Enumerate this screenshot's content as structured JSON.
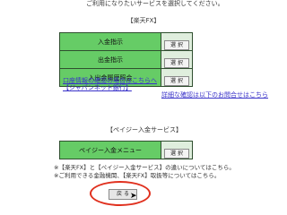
{
  "intro": "ご利用になりたいサービスを選択してください。",
  "section1": {
    "heading": "【楽天FX】",
    "rows": [
      {
        "label": "入金指示",
        "button": "選 択"
      },
      {
        "label": "出金指示",
        "button": "選 択"
      },
      {
        "label": "入出金履歴照会",
        "button": "選 択"
      }
    ],
    "link_line1": "口座情報の確認の場合はこちらへ",
    "link_line2": "【ジャパンネット銀行】",
    "right_link": "詳細な確認は以下のお問合せはこちら"
  },
  "section2": {
    "heading": "【ペイジー入金サービス】",
    "rows": [
      {
        "label": "ペイジー入金メニュー",
        "button": "選 択"
      }
    ]
  },
  "notes": [
    "※【楽天FX】と【ペイジー入金サービス】の違いについてはこちら。",
    "※ご利用できる金融機関、【楽天FX】取扱等についてはこちら。"
  ],
  "submit_label": "戻 る"
}
